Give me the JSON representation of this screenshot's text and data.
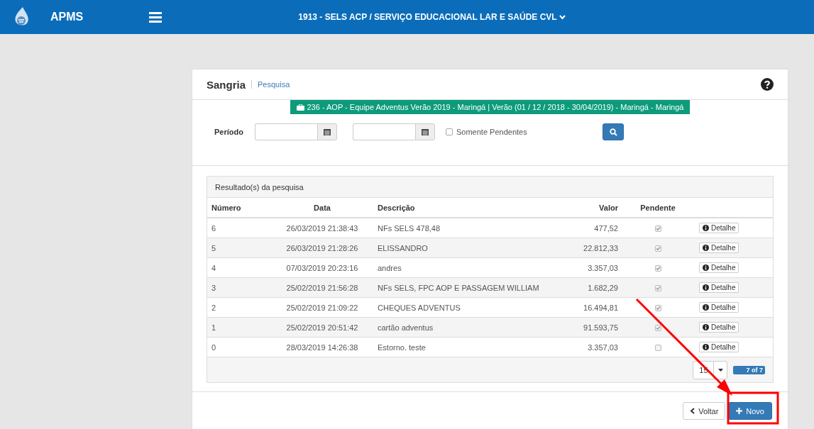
{
  "header": {
    "brand": "APMS",
    "organization": "1913 - SELS ACP / SERVIÇO EDUCACIONAL LAR E SAÚDE CVL"
  },
  "page": {
    "title": "Sangria",
    "subtitle": "Pesquisa"
  },
  "context_banner": "236 - AOP - Equipe Adventus Verão 2019 - Maringá | Verão (01 / 12 / 2018 - 30/04/2019) - Maringá - Maringá",
  "filters": {
    "period_label": "Período",
    "only_pending": {
      "label": "Somente Pendentes",
      "checked": false
    }
  },
  "results": {
    "title": "Resultado(s) da pesquisa",
    "columns": [
      "Número",
      "Data",
      "Descrição",
      "Valor",
      "Pendente"
    ],
    "rows": [
      {
        "number": "6",
        "date": "26/03/2019 21:38:43",
        "description": "NFs SELS 478,48",
        "value": "477,52",
        "pending": true,
        "action": "Detalhe"
      },
      {
        "number": "5",
        "date": "26/03/2019 21:28:26",
        "description": "ELISSANDRO",
        "value": "22.812,33",
        "pending": true,
        "action": "Detalhe"
      },
      {
        "number": "4",
        "date": "07/03/2019 20:23:16",
        "description": "andres",
        "value": "3.357,03",
        "pending": true,
        "action": "Detalhe"
      },
      {
        "number": "3",
        "date": "25/02/2019 21:56:28",
        "description": "NFs SELS, FPC AOP E PASSAGEM WILLIAM",
        "value": "1.682,29",
        "pending": true,
        "action": "Detalhe"
      },
      {
        "number": "2",
        "date": "25/02/2019 21:09:22",
        "description": "CHEQUES ADVENTUS",
        "value": "16.494,81",
        "pending": true,
        "action": "Detalhe"
      },
      {
        "number": "1",
        "date": "25/02/2019 20:51:42",
        "description": "cartão adventus",
        "value": "91.593,75",
        "pending": true,
        "action": "Detalhe"
      },
      {
        "number": "0",
        "date": "28/03/2019 14:26:38",
        "description": "Estorno. teste",
        "value": "3.357,03",
        "pending": false,
        "action": "Detalhe"
      }
    ],
    "page_size": "15",
    "range": "7 of 7"
  },
  "buttons": [
    {
      "kind": "back",
      "label": "Voltar"
    },
    {
      "kind": "new",
      "label": "Novo"
    }
  ],
  "annotations": {
    "arrow": true,
    "highlight_box": true
  }
}
